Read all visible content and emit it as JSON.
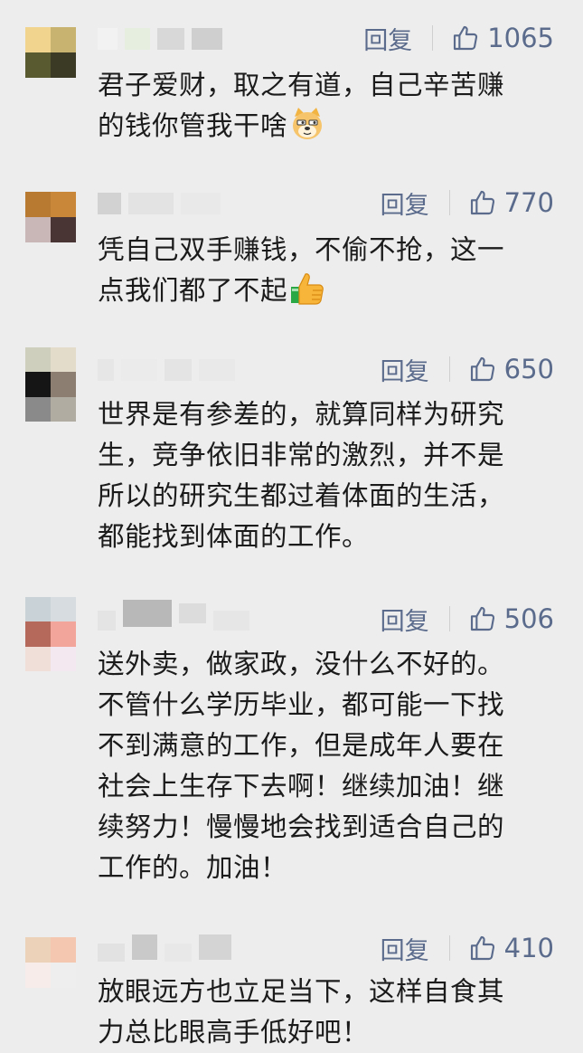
{
  "reply_label": "回复",
  "comments": [
    {
      "likes": "1065",
      "text": "君子爱财，取之有道，自己辛苦赚\n的钱你管我干啥",
      "emoji": "dog-emoji",
      "avatar_colors": [
        "#f1d48e",
        "#c8b470",
        "#5a5a30",
        "#3b3a25"
      ]
    },
    {
      "likes": "770",
      "text": "凭自己双手赚钱，不偷不抢，这一\n点我们都了不起",
      "emoji": "thumbs-up-emoji",
      "avatar_colors": [
        "#b87930",
        "#c9873a",
        "#c9b6b6",
        "#4a3535"
      ]
    },
    {
      "likes": "650",
      "text": "世界是有参差的，就算同样为研究\n生，竞争依旧非常的激烈，并不是\n所以的研究生都过着体面的生活，\n都能找到体面的工作。",
      "avatar_colors": [
        "#cfcfbe",
        "#e3dccb",
        "#151515",
        "#8c7f72",
        "#8a8a8a",
        "#b0aca2"
      ]
    },
    {
      "likes": "506",
      "text": "送外卖，做家政，没什么不好的。\n不管什么学历毕业，都可能一下找\n不到满意的工作，但是成年人要在\n社会上生存下去啊！继续加油！继\n续努力！慢慢地会找到适合自己的\n工作的。加油！",
      "avatar_colors": [
        "#c9d2d6",
        "#d6dcdf",
        "#b5695a",
        "#f2a59b",
        "#f0ded8",
        "#f3e8f0"
      ]
    },
    {
      "likes": "410",
      "text": "放眼远方也立足当下，这样自食其\n力总比眼高手低好吧！",
      "avatar_colors": [
        "#ecd2b8",
        "#f4c7b0",
        "#f7ecea",
        "#eeeeee"
      ]
    }
  ]
}
